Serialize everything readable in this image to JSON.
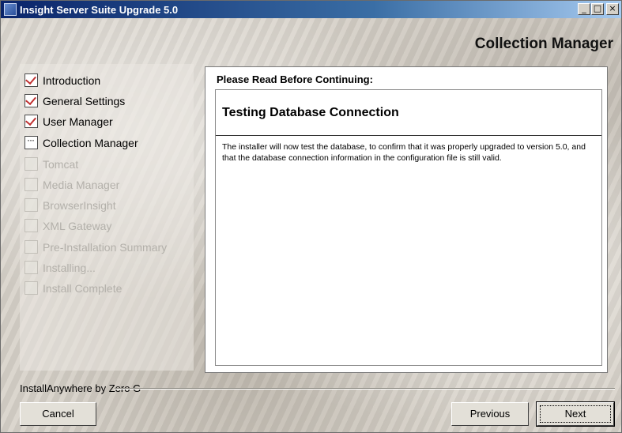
{
  "window": {
    "title": "Insight Server Suite Upgrade 5.0",
    "controls": [
      "_",
      "□",
      "×"
    ]
  },
  "header": {
    "title": "Collection Manager"
  },
  "steps": [
    {
      "label": "Introduction",
      "state": "done"
    },
    {
      "label": "General Settings",
      "state": "done"
    },
    {
      "label": "User Manager",
      "state": "done"
    },
    {
      "label": "Collection Manager",
      "state": "current"
    },
    {
      "label": "Tomcat",
      "state": "pending"
    },
    {
      "label": "Media Manager",
      "state": "pending"
    },
    {
      "label": "BrowserInsight",
      "state": "pending"
    },
    {
      "label": "XML Gateway",
      "state": "pending"
    },
    {
      "label": "Pre-Installation Summary",
      "state": "pending"
    },
    {
      "label": "Installing...",
      "state": "pending"
    },
    {
      "label": "Install Complete",
      "state": "pending"
    }
  ],
  "content": {
    "heading": "Please Read Before Continuing:",
    "title": "Testing Database Connection",
    "body": "The installer will now test the database, to confirm that it was properly upgraded to version 5.0, and that the database connection information in the configuration file is still valid."
  },
  "footer": {
    "vendor": "InstallAnywhere by Zero G",
    "cancel_label": "Cancel",
    "previous_label": "Previous",
    "next_label": "Next"
  }
}
